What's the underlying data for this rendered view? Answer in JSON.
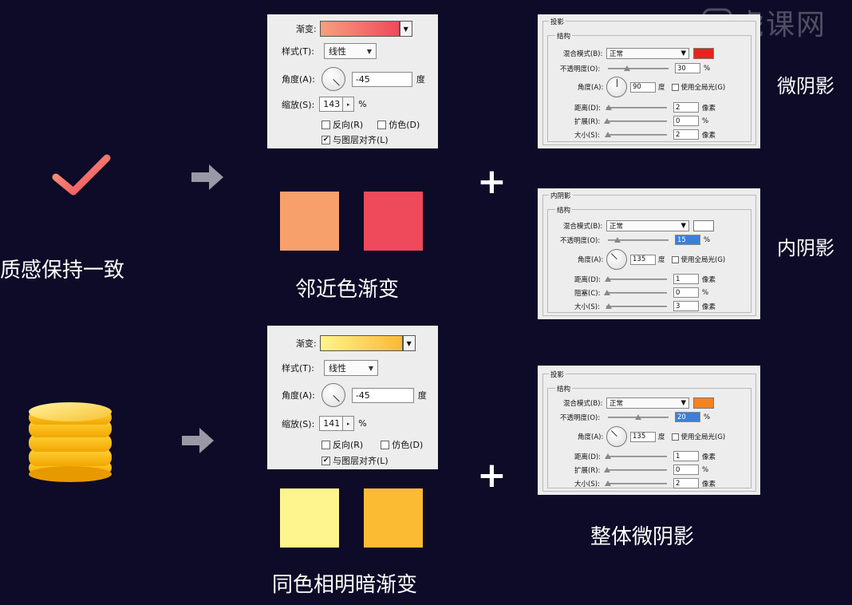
{
  "watermark": {
    "text": "虎课网",
    "icon": "play-icon"
  },
  "left": {
    "top_label": "质感保持一致",
    "top_icon": "checkmark-icon",
    "bottom_icon": "coin-stack-icon"
  },
  "gradient_panel_top": {
    "gradient_label": "渐变:",
    "style_label": "样式(T):",
    "style_value": "线性",
    "angle_label": "角度(A):",
    "angle_value": "-45",
    "angle_unit": "度",
    "scale_label": "缩放(S):",
    "scale_value": "143",
    "scale_unit": "%",
    "reverse_label": "反向(R)",
    "dither_label": "仿色(D)",
    "align_label": "与图层对齐(L)",
    "gradient_colors": [
      "#f79f80",
      "#ef4a5b"
    ]
  },
  "gradient_panel_bottom": {
    "gradient_label": "渐变:",
    "style_label": "样式(T):",
    "style_value": "线性",
    "angle_label": "角度(A):",
    "angle_value": "-45",
    "angle_unit": "度",
    "scale_label": "缩放(S):",
    "scale_value": "141",
    "scale_unit": "%",
    "reverse_label": "反向(R)",
    "dither_label": "仿色(D)",
    "align_label": "与图层对齐(L)",
    "gradient_colors": [
      "#fff48c",
      "#f9b935"
    ]
  },
  "swatches_top": {
    "colors": [
      "#f8a06b",
      "#ef4a5b"
    ],
    "caption": "邻近色渐变"
  },
  "swatches_bottom": {
    "colors": [
      "#fff58e",
      "#fbbb33"
    ],
    "caption": "同色相明暗渐变"
  },
  "plus_symbol": "+",
  "fx_drop_shadow_top": {
    "title": "投影",
    "group": "结构",
    "blend_label": "混合模式(B):",
    "blend_value": "正常",
    "color": "#e8231f",
    "opacity_label": "不透明度(O):",
    "opacity_value": "30",
    "percent": "%",
    "angle_label": "角度(A):",
    "angle_value": "90",
    "angle_unit": "度",
    "global_light": "使用全局光(G)",
    "r1_label": "距离(D):",
    "r1_value": "2",
    "r1_unit": "像素",
    "r2_label": "扩展(R):",
    "r2_value": "0",
    "r2_unit": "%",
    "r3_label": "大小(S):",
    "r3_value": "2",
    "r3_unit": "像素",
    "side_label": "微阴影"
  },
  "fx_inner_shadow": {
    "title": "内阴影",
    "group": "结构",
    "blend_label": "混合模式(B):",
    "blend_value": "正常",
    "color": "#ffffff",
    "opacity_label": "不透明度(O):",
    "opacity_value": "15",
    "percent": "%",
    "angle_label": "角度(A):",
    "angle_value": "135",
    "angle_unit": "度",
    "global_light": "使用全局光(G)",
    "r1_label": "距离(D):",
    "r1_value": "1",
    "r1_unit": "像素",
    "r2_label": "阻塞(C):",
    "r2_value": "0",
    "r2_unit": "%",
    "r3_label": "大小(S):",
    "r3_value": "3",
    "r3_unit": "像素",
    "side_label": "内阴影"
  },
  "fx_drop_shadow_bottom": {
    "title": "投影",
    "group": "结构",
    "blend_label": "混合模式(B):",
    "blend_value": "正常",
    "color": "#f5821f",
    "opacity_label": "不透明度(O):",
    "opacity_value": "20",
    "percent": "%",
    "angle_label": "角度(A):",
    "angle_value": "135",
    "angle_unit": "度",
    "global_light": "使用全局光(G)",
    "r1_label": "距离(D):",
    "r1_value": "1",
    "r1_unit": "像素",
    "r2_label": "扩展(R):",
    "r2_value": "0",
    "r2_unit": "%",
    "r3_label": "大小(S):",
    "r3_value": "2",
    "r3_unit": "像素",
    "caption": "整体微阴影"
  }
}
